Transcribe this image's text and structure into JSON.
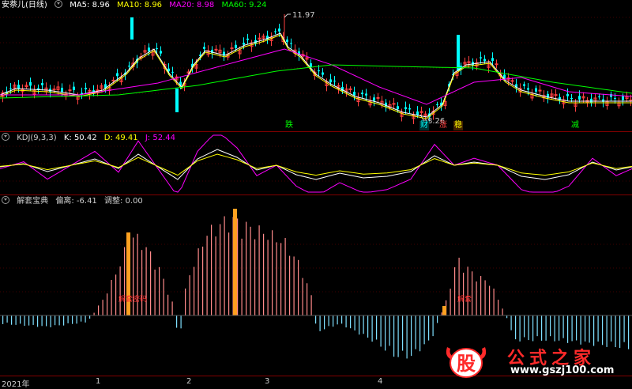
{
  "main_panel": {
    "title": "安萘儿(日线)",
    "indicators": [
      {
        "label": "MA5: 8.96",
        "color": "#ffffff"
      },
      {
        "label": "MA10: 8.96",
        "color": "#ffff00"
      },
      {
        "label": "MA20: 8.98",
        "color": "#ff00ff"
      },
      {
        "label": "MA60: 9.24",
        "color": "#00ff00"
      }
    ],
    "high_label": "11.97",
    "low_label": "8.26",
    "tags": [
      {
        "text": "跌",
        "color": "#00ff00"
      },
      {
        "text": "财",
        "color": "#00ffff"
      },
      {
        "text": "涨",
        "color": "#ff4040"
      },
      {
        "text": "稳",
        "color": "#ffff00"
      },
      {
        "text": "减",
        "color": "#00ff00"
      }
    ]
  },
  "kdj_panel": {
    "title": "KDJ(9,3,3)",
    "k_label": "K: 50.42",
    "d_label": "D: 49.41",
    "j_label": "J: 52.44",
    "k_color": "#ffffff",
    "d_color": "#ffff00",
    "j_color": "#ff00ff"
  },
  "osc_panel": {
    "title": "解套宝典",
    "dev_label": "偏离: -6.41",
    "adj_label": "调整: 0.00",
    "signal_labels": [
      "解套密码",
      "解套"
    ]
  },
  "x_axis": {
    "labels": [
      "2021年",
      "1",
      "2",
      "3",
      "4"
    ]
  },
  "logo": {
    "brand": "公式之家",
    "url": "www.gszj100.com",
    "glyph": "股"
  }
}
